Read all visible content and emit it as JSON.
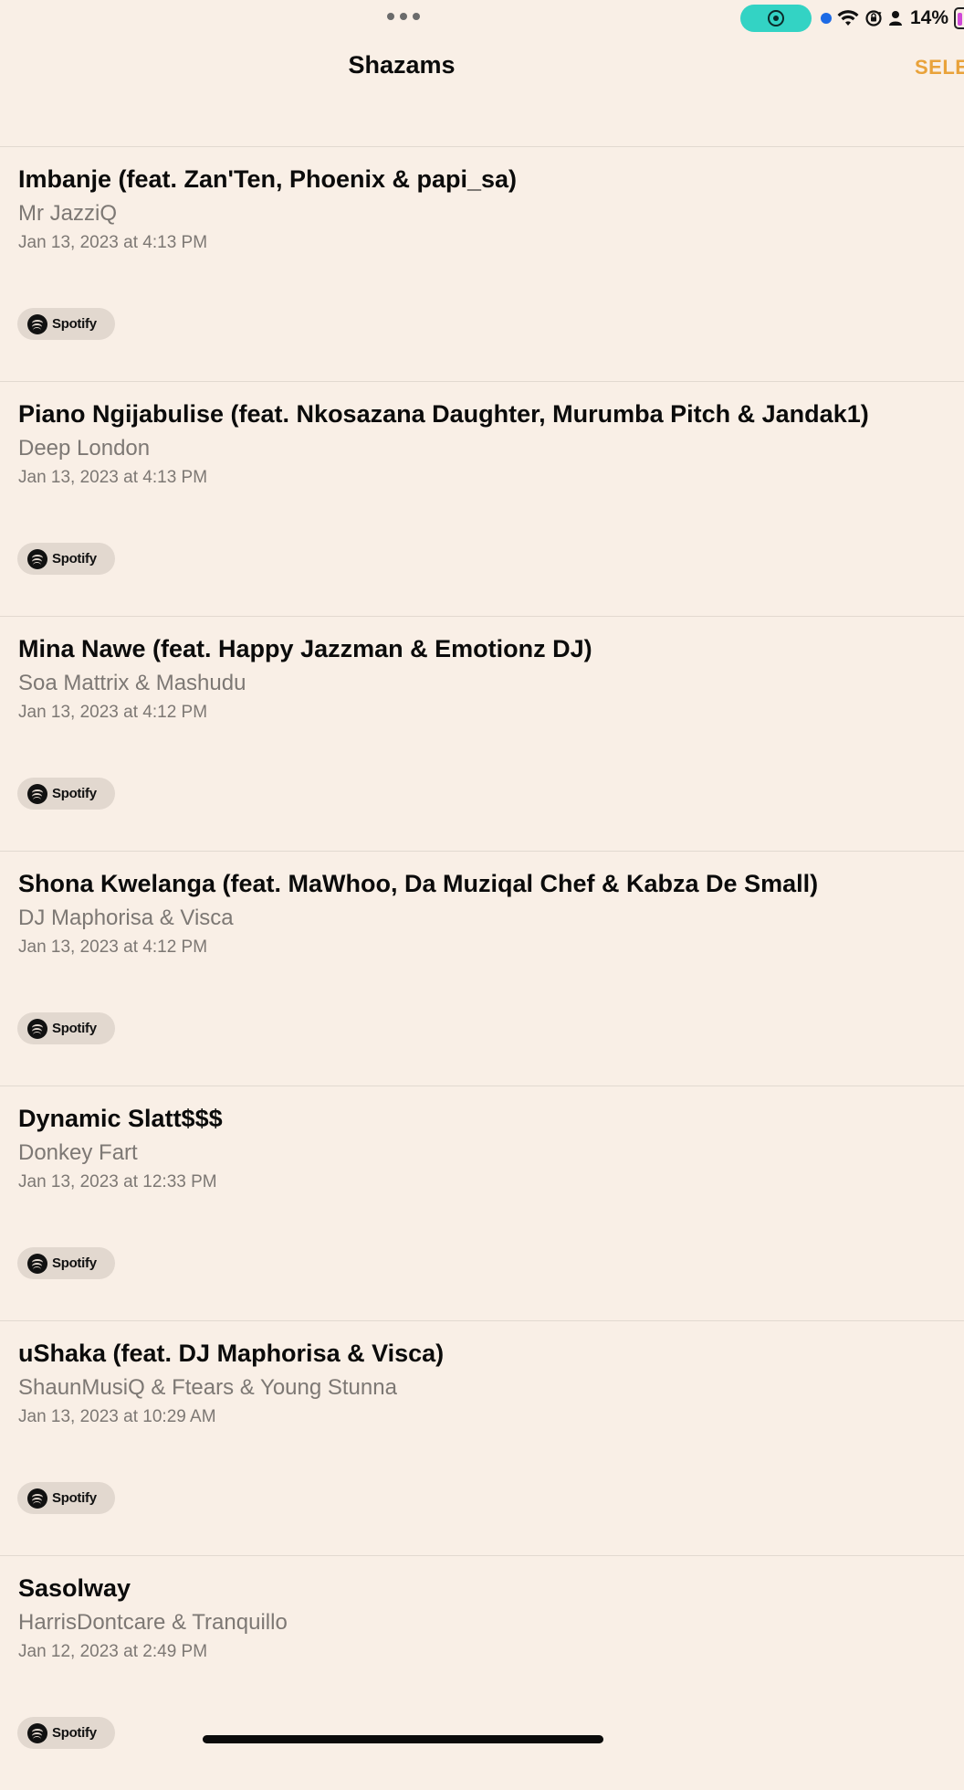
{
  "status_bar": {
    "battery": "14%",
    "icons": [
      "multitasking-dots-icon",
      "screen-recording-icon",
      "privacy-indicator-dot",
      "wifi-icon",
      "orientation-lock-icon",
      "person-icon",
      "battery-icon"
    ],
    "accent_colors": {
      "screen_record": "#33d3c4",
      "privacy_dot": "#1d6ae5",
      "battery_fill": "#d04ad8"
    }
  },
  "nav": {
    "title": "Shazams",
    "select_label": "SELE",
    "select_color": "#e9a23a"
  },
  "shazams": [
    {
      "title": "Imbanje (feat. Zan'Ten, Phoenix & papi_sa)",
      "artist": "Mr JazziQ",
      "date": "Jan 13, 2023 at 4:13 PM",
      "provider": "Spotify"
    },
    {
      "title": "Piano Ngijabulise (feat. Nkosazana Daughter, Murumba Pitch & Jandak1)",
      "artist": "Deep London",
      "date": "Jan 13, 2023 at 4:13 PM",
      "provider": "Spotify"
    },
    {
      "title": "Mina Nawe (feat. Happy Jazzman & Emotionz DJ)",
      "artist": "Soa Mattrix & Mashudu",
      "date": "Jan 13, 2023 at 4:12 PM",
      "provider": "Spotify"
    },
    {
      "title": "Shona Kwelanga (feat. MaWhoo, Da Muziqal Chef & Kabza De Small)",
      "artist": "DJ Maphorisa & Visca",
      "date": "Jan 13, 2023 at 4:12 PM",
      "provider": "Spotify"
    },
    {
      "title": "Dynamic Slatt$$$",
      "artist": "Donkey Fart",
      "date": "Jan 13, 2023 at 12:33 PM",
      "provider": "Spotify"
    },
    {
      "title": "uShaka (feat. DJ Maphorisa & Visca)",
      "artist": "ShaunMusiQ & Ftears & Young Stunna",
      "date": "Jan 13, 2023 at 10:29 AM",
      "provider": "Spotify"
    },
    {
      "title": "Sasolway",
      "artist": "HarrisDontcare & Tranquillo",
      "date": "Jan 12, 2023 at 2:49 PM",
      "provider": "Spotify"
    }
  ]
}
